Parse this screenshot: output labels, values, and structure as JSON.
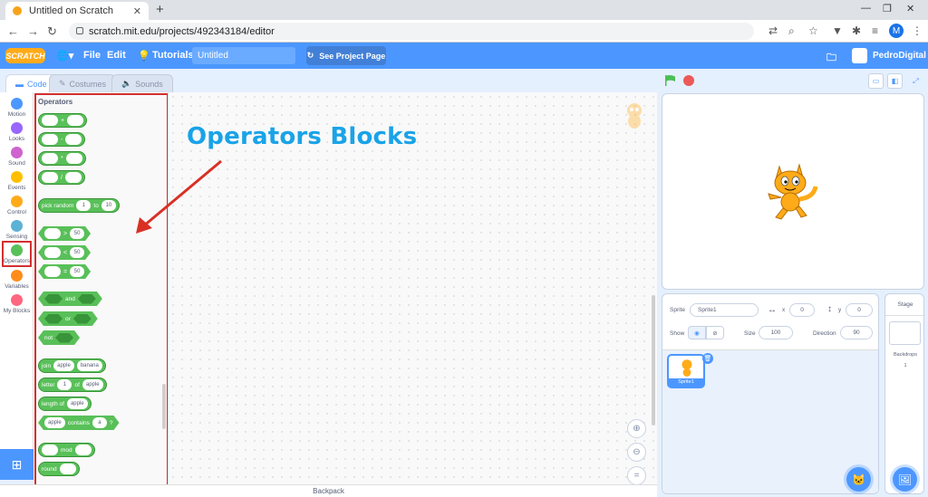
{
  "browser": {
    "tab_title": "Untitled on Scratch",
    "tab_close": "✕",
    "new_tab": "+",
    "url": "scratch.mit.edu/projects/492343184/editor",
    "profile_initial": "M"
  },
  "menubar": {
    "logo": "SCRATCH",
    "file": "File",
    "edit": "Edit",
    "tutorials": "Tutorials",
    "project_title": "Untitled",
    "see_project_page": "See Project Page",
    "username": "PedroDigital"
  },
  "editor_tabs": {
    "code": "Code",
    "costumes": "Costumes",
    "sounds": "Sounds"
  },
  "categories": [
    {
      "label": "Motion",
      "color": "#4c97ff"
    },
    {
      "label": "Looks",
      "color": "#9966ff"
    },
    {
      "label": "Sound",
      "color": "#cf63cf"
    },
    {
      "label": "Events",
      "color": "#ffbf00"
    },
    {
      "label": "Control",
      "color": "#ffab19"
    },
    {
      "label": "Sensing",
      "color": "#5cb1d6"
    },
    {
      "label": "Operators",
      "color": "#59c059"
    },
    {
      "label": "Variables",
      "color": "#ff8c1a"
    },
    {
      "label": "My Blocks",
      "color": "#ff6680"
    }
  ],
  "palette": {
    "title": "Operators",
    "op_add": "+",
    "op_sub": "-",
    "op_mul": "*",
    "op_div": "/",
    "pick_random": "pick random",
    "to": "to",
    "rand_from": "1",
    "rand_to": "10",
    "gt": ">",
    "lt": "<",
    "eq": "=",
    "cmp_value": "50",
    "and": "and",
    "or": "or",
    "not": "not",
    "join": "join",
    "join_a": "apple",
    "join_b": "banana",
    "letter": "letter",
    "letter_n": "1",
    "of": "of",
    "letter_word": "apple",
    "length_of": "length of",
    "length_word": "apple",
    "contains_word": "apple",
    "contains": "contains",
    "contains_letter": "a",
    "question": "?",
    "mod": "mod",
    "round": "round"
  },
  "annotation": "Operators Blocks",
  "backpack": "Backpack",
  "sprite": {
    "label_sprite": "Sprite",
    "name": "Sprite1",
    "label_x": "x",
    "x": "0",
    "label_y": "y",
    "y": "0",
    "label_show": "Show",
    "label_size": "Size",
    "size": "100",
    "label_direction": "Direction",
    "direction": "90",
    "thumb_label": "Sprite1"
  },
  "stage_pane": {
    "title": "Stage",
    "backdrops_label": "Backdrops",
    "backdrops_count": "1"
  }
}
